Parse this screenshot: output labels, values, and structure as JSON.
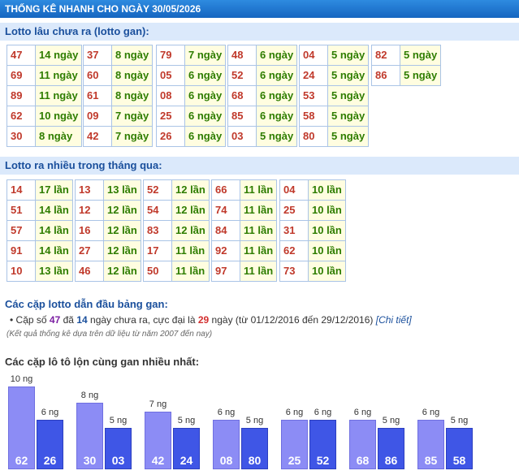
{
  "title": "THỐNG KÊ NHANH CHO NGÀY 30/05/2026",
  "gan": {
    "heading": "Lotto lâu chưa ra (lotto gan):",
    "columns": [
      [
        [
          "47",
          "14 ngày"
        ],
        [
          "69",
          "11 ngày"
        ],
        [
          "89",
          "11 ngày"
        ],
        [
          "62",
          "10 ngày"
        ],
        [
          "30",
          "8 ngày"
        ]
      ],
      [
        [
          "37",
          "8 ngày"
        ],
        [
          "60",
          "8 ngày"
        ],
        [
          "61",
          "8 ngày"
        ],
        [
          "09",
          "7 ngày"
        ],
        [
          "42",
          "7 ngày"
        ]
      ],
      [
        [
          "79",
          "7 ngày"
        ],
        [
          "05",
          "6 ngày"
        ],
        [
          "08",
          "6 ngày"
        ],
        [
          "25",
          "6 ngày"
        ],
        [
          "26",
          "6 ngày"
        ]
      ],
      [
        [
          "48",
          "6 ngày"
        ],
        [
          "52",
          "6 ngày"
        ],
        [
          "68",
          "6 ngày"
        ],
        [
          "85",
          "6 ngày"
        ],
        [
          "03",
          "5 ngày"
        ]
      ],
      [
        [
          "04",
          "5 ngày"
        ],
        [
          "24",
          "5 ngày"
        ],
        [
          "53",
          "5 ngày"
        ],
        [
          "58",
          "5 ngày"
        ],
        [
          "80",
          "5 ngày"
        ]
      ],
      [
        [
          "82",
          "5 ngày"
        ],
        [
          "86",
          "5 ngày"
        ]
      ]
    ]
  },
  "nhieu": {
    "heading": "Lotto ra nhiều trong tháng qua:",
    "columns": [
      [
        [
          "14",
          "17 lần"
        ],
        [
          "51",
          "14 lần"
        ],
        [
          "57",
          "14 lần"
        ],
        [
          "91",
          "14 lần"
        ],
        [
          "10",
          "13 lần"
        ]
      ],
      [
        [
          "13",
          "13 lần"
        ],
        [
          "12",
          "12 lần"
        ],
        [
          "16",
          "12 lần"
        ],
        [
          "27",
          "12 lần"
        ],
        [
          "46",
          "12 lần"
        ]
      ],
      [
        [
          "52",
          "12 lần"
        ],
        [
          "54",
          "12 lần"
        ],
        [
          "83",
          "12 lần"
        ],
        [
          "17",
          "11 lần"
        ],
        [
          "50",
          "11 lần"
        ]
      ],
      [
        [
          "66",
          "11 lần"
        ],
        [
          "74",
          "11 lần"
        ],
        [
          "84",
          "11 lần"
        ],
        [
          "92",
          "11 lần"
        ],
        [
          "97",
          "11 lần"
        ]
      ],
      [
        [
          "04",
          "10 lần"
        ],
        [
          "25",
          "10 lần"
        ],
        [
          "31",
          "10 lần"
        ],
        [
          "62",
          "10 lần"
        ],
        [
          "73",
          "10 lần"
        ]
      ]
    ]
  },
  "pair": {
    "heading": "Các cặp lotto dẫn đầu bảng gan:",
    "line": {
      "bullet": "•",
      "p1": "Cặp số",
      "num": "47",
      "p2": "đã",
      "days": "14",
      "p3": "ngày chưa ra, cực đại là",
      "max": "29",
      "p4": "ngày (từ 01/12/2016 đến 29/12/2016)",
      "link": "[Chi tiết]"
    },
    "note": "(Kết quả thống kê dựa trên dữ liệu từ năm 2007 đến nay)"
  },
  "chart_data": {
    "type": "bar",
    "title": "Các cặp lô tô lộn cùng gan nhiều nhất:",
    "unit": "ng",
    "pairs": [
      {
        "a": {
          "num": "62",
          "value": 10
        },
        "b": {
          "num": "26",
          "value": 6
        }
      },
      {
        "a": {
          "num": "30",
          "value": 8
        },
        "b": {
          "num": "03",
          "value": 5
        }
      },
      {
        "a": {
          "num": "42",
          "value": 7
        },
        "b": {
          "num": "24",
          "value": 5
        }
      },
      {
        "a": {
          "num": "08",
          "value": 6
        },
        "b": {
          "num": "80",
          "value": 5
        }
      },
      {
        "a": {
          "num": "25",
          "value": 6
        },
        "b": {
          "num": "52",
          "value": 6
        }
      },
      {
        "a": {
          "num": "68",
          "value": 6
        },
        "b": {
          "num": "86",
          "value": 5
        }
      },
      {
        "a": {
          "num": "85",
          "value": 6
        },
        "b": {
          "num": "58",
          "value": 5
        }
      }
    ],
    "colors": {
      "first": "#8c8cf5",
      "second": "#3f56e6"
    }
  }
}
